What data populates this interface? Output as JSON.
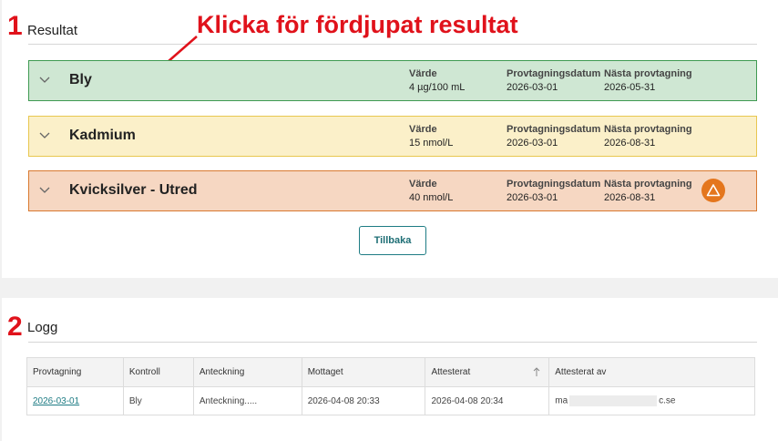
{
  "annotation": {
    "text": "Klicka för fördjupat resultat"
  },
  "section1": {
    "number": "1",
    "title": "Resultat"
  },
  "section2": {
    "number": "2",
    "title": "Logg"
  },
  "results": [
    {
      "name": "Bly",
      "status_color": "#cfe7d3",
      "value_label": "Värde",
      "value": "4 µg/100 mL",
      "date_label": "Provtagningsdatum",
      "date": "2026-03-01",
      "next_label": "Nästa provtagning",
      "next": "2026-05-31"
    },
    {
      "name": "Kadmium",
      "status_color": "#fbf0c9",
      "value_label": "Värde",
      "value": "15 nmol/L",
      "date_label": "Provtagningsdatum",
      "date": "2026-03-01",
      "next_label": "Nästa provtagning",
      "next": "2026-08-31"
    },
    {
      "name": "Kvicksilver - Utred",
      "status_color": "#f6d7c2",
      "value_label": "Värde",
      "value": "40 nmol/L",
      "date_label": "Provtagningsdatum",
      "date": "2026-03-01",
      "next_label": "Nästa provtagning",
      "next": "2026-08-31",
      "icon": "warning-triangle-icon"
    }
  ],
  "back_button": "Tillbaka",
  "log": {
    "headers": [
      "Provtagning",
      "Kontroll",
      "Anteckning",
      "Mottaget",
      "Attesterat",
      "Attesterat av"
    ],
    "rows": [
      {
        "provtagning": "2026-03-01",
        "kontroll": "Bly",
        "anteckning": "Anteckning.....",
        "mottaget": "2026-04-08 20:33",
        "attesterat": "2026-04-08 20:34",
        "attesterat_av_prefix": "ma",
        "attesterat_av_suffix": "c.se"
      }
    ]
  }
}
